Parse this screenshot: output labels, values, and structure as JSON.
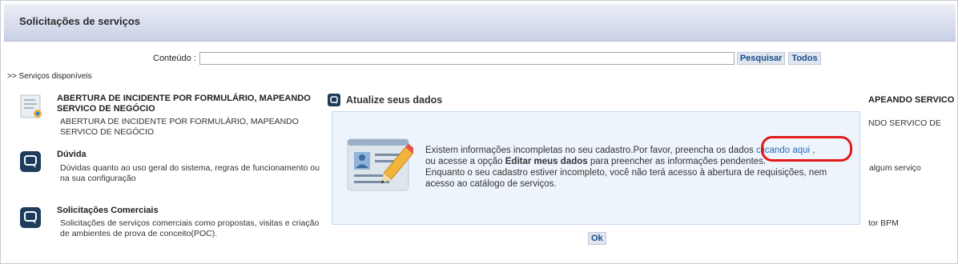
{
  "header": {
    "title": "Solicitações de serviços"
  },
  "search": {
    "label": "Conteúdo :",
    "value": "",
    "search_button": "Pesquisar",
    "all_button": "Todos"
  },
  "services_label": ">> Serviços disponíveis",
  "services": [
    {
      "name": "ABERTURA DE INCIDENTE POR FORMULÁRIO, MAPEANDO SERVICO DE NEGÓCIO",
      "desc": "ABERTURA DE INCIDENTE POR FORMULÁRIO, MAPEANDO SERVICO DE NEGÓCIO"
    },
    {
      "name": "Dúvida",
      "desc": "Dúvidas quanto ao uso geral do sistema, regras de funcionamento ou na sua configuração"
    },
    {
      "name": "Solicitações Comerciais",
      "desc": "Solicitações de serviços comerciais como propostas, visitas e criação de ambientes de prova de conceito(POC)."
    }
  ],
  "right_fragments": [
    "APEANDO SERVICO",
    "NDO SERVICO DE",
    "algum serviço",
    "tor BPM"
  ],
  "modal": {
    "title": "Atualize seus dados",
    "msg_part1": "Existem informações incompletas no seu cadastro.Por favor, preencha os dados ",
    "link_text": "clicando aqui",
    "msg_part2": " ,",
    "msg_part3": "ou acesse a opção ",
    "msg_bold": "Editar meus dados",
    "msg_part4": " para preencher as informações pendentes.",
    "msg_line3": "Enquanto o seu cadastro estiver incompleto, você não terá acesso à abertura de requisições, nem acesso ao catálogo de serviços.",
    "ok_button": "Ok"
  },
  "colors": {
    "header_top": "#eceff7",
    "header_bottom": "#c9cfe6",
    "link": "#2a6bb8",
    "highlight_circle": "#e01b1b",
    "button_text": "#1b4e8a"
  }
}
